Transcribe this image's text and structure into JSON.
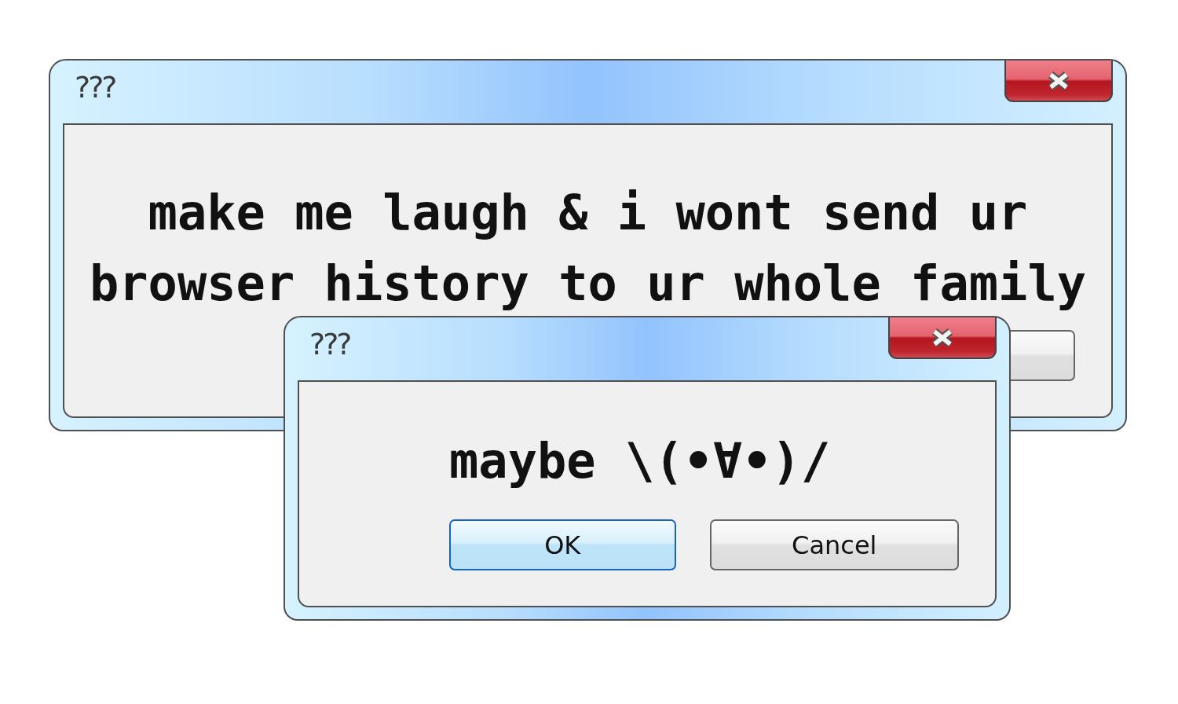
{
  "windows": [
    {
      "title": "???",
      "message": "make me laugh & i wont send ur browser history to ur whole family",
      "buttons": [
        {
          "default": false
        }
      ]
    },
    {
      "title": "???",
      "message": "maybe \\(•∀•)/",
      "buttons": [
        {
          "label": "OK",
          "default": true
        },
        {
          "label": "Cancel",
          "default": false
        }
      ]
    }
  ]
}
